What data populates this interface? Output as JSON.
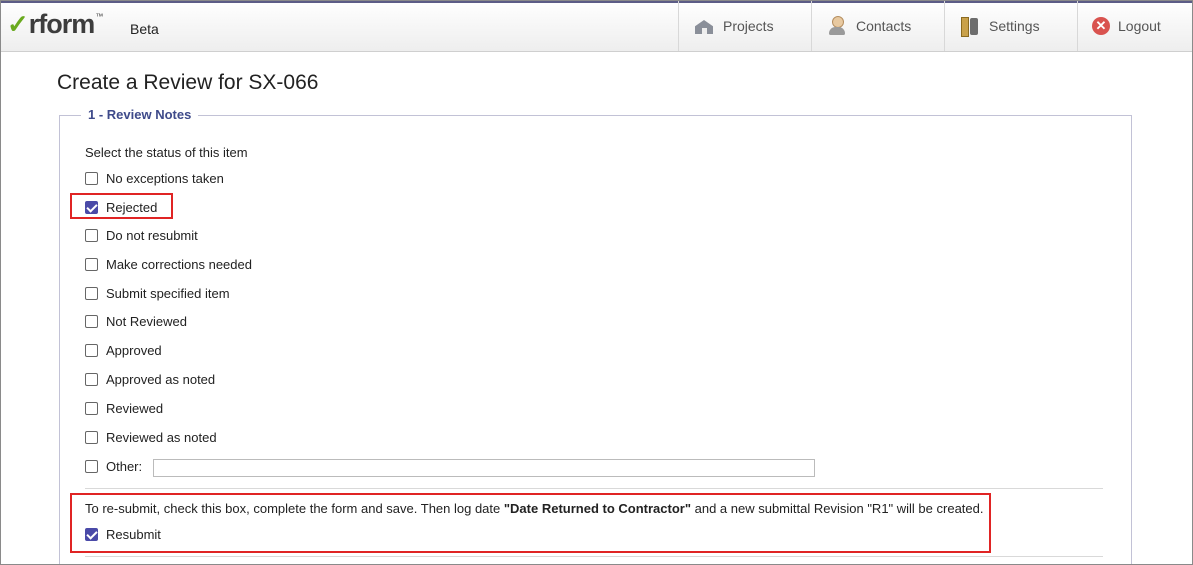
{
  "header": {
    "logo_text": "rform",
    "logo_tm": "™",
    "beta_label": "Beta",
    "nav": {
      "projects": "Projects",
      "contacts": "Contacts",
      "settings": "Settings",
      "logout": "Logout"
    }
  },
  "page": {
    "title": "Create a Review for SX-066",
    "section_legend": "1 - Review Notes",
    "status_prompt": "Select the status of this item",
    "status_options": [
      {
        "label": "No exceptions taken",
        "checked": false
      },
      {
        "label": "Rejected",
        "checked": true
      },
      {
        "label": "Do not resubmit",
        "checked": false
      },
      {
        "label": "Make corrections needed",
        "checked": false
      },
      {
        "label": "Submit specified item",
        "checked": false
      },
      {
        "label": "Not Reviewed",
        "checked": false
      },
      {
        "label": "Approved",
        "checked": false
      },
      {
        "label": "Approved as noted",
        "checked": false
      },
      {
        "label": "Reviewed",
        "checked": false
      },
      {
        "label": "Reviewed as noted",
        "checked": false
      }
    ],
    "other_label": "Other:",
    "other_value": "",
    "resubmit_note_pre": "To re-submit, check this box, complete the form and save. Then log date ",
    "resubmit_note_bold": "\"Date Returned to Contractor\"",
    "resubmit_note_post": " and a new submittal Revision \"R1\" will be created.",
    "resubmit_label": "Resubmit",
    "resubmit_checked": true
  },
  "colors": {
    "highlight": "#e02424",
    "checkbox_checked": "#4a4aa8",
    "legend_text": "#3e4a8a",
    "logo_check": "#6aaa1f"
  }
}
